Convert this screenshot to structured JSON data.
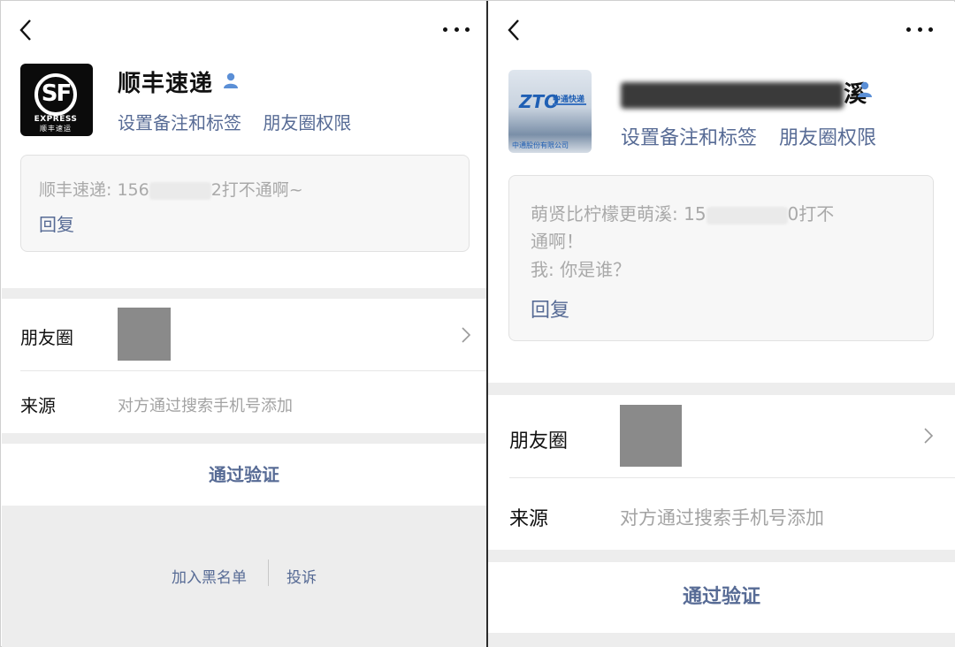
{
  "left_panel": {
    "contact_name": "顺丰速递",
    "avatar_text": {
      "logo": "SF",
      "brand_en": "EXPRESS",
      "brand_cn": "顺丰速运"
    },
    "links": {
      "remark": "设置备注和标签",
      "moments_perm": "朋友圈权限"
    },
    "message": {
      "prefix": "顺丰速递: 156",
      "suffix": "2打不通啊~"
    },
    "reply_label": "回复",
    "moments_label": "朋友圈",
    "source_label": "来源",
    "source_value": "对方通过搜索手机号添加",
    "verify_button": "通过验证",
    "blacklist_button": "加入黑名单",
    "report_button": "投诉"
  },
  "right_panel": {
    "contact_name_visible": "溪",
    "avatar_text": {
      "logo": "ZTO",
      "brand_cn": "中通快递",
      "bottom": "中通股份有限公司"
    },
    "links": {
      "remark": "设置备注和标签",
      "moments_perm": "朋友圈权限"
    },
    "message": {
      "line1_prefix": "萌贤比柠檬更萌溪: 15",
      "line1_suffix": "0打不",
      "line2": "通啊！",
      "line3": "我: 你是谁？"
    },
    "reply_label": "回复",
    "moments_label": "朋友圈",
    "source_label": "来源",
    "source_value": "对方通过搜索手机号添加",
    "verify_button": "通过验证"
  },
  "colors": {
    "link": "#576b95",
    "gap": "#ededed",
    "placeholder_thumb": "#8a8a8a",
    "person_icon": "#5b8fd6"
  },
  "icons": [
    "back-arrow-icon",
    "more-dots-icon",
    "person-icon",
    "chevron-right-icon"
  ]
}
